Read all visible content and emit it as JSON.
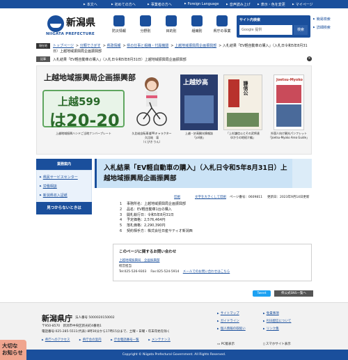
{
  "utility": {
    "items": [
      "本文へ",
      "初めての方へ",
      "事業者の方へ",
      "Foreign Language",
      "音声読み上げ",
      "表示・色を変更",
      "マイページ"
    ]
  },
  "header": {
    "logo_ja": "新潟県",
    "logo_en": "NIIGATA PREFECTURE",
    "nav": [
      "防災情報",
      "分野別",
      "目的別",
      "組織別",
      "県庁の事業"
    ],
    "search_title": "サイト内検索",
    "search_placeholder": "Google 提供",
    "search_button": "検索",
    "side_links": [
      "簡易検索",
      "詳細検索"
    ]
  },
  "breadcrumb": {
    "tag": "現在地",
    "items": [
      "トップページ",
      "分類でさがす",
      "県政情報",
      "県の仕事と組織・付属機関",
      "上越地域振興局企画振興部"
    ],
    "current": "入札結果「EV軽自動車の購入」（入札日令和5年8月31日）上越地域振興局企画振興部"
  },
  "news": {
    "tag": "記事",
    "text": "入札結果「EV軽自動車の購入」（入札日令和5年8月31日）上越地域振興局企画振興部"
  },
  "banner": {
    "title": "上越地域振興局企画振興部",
    "plate_line1": "上越599",
    "plate_line2": "は20-20",
    "captions": [
      "上越地域振興ハンドご当地ナンバープレート",
      "久比岐自転車道PRキャラクター\n久比岐　凛\n（くびき りん）",
      "上越・妙高観光情報誌\n「joli旅」",
      "「上杉謙信公とその武将達\nゆかりの地紹介編」",
      "外国人向け観光パンフレット\n「Joetsu-Myoko Area Guide」"
    ],
    "book_titles": [
      "上越妙高",
      "謙信公",
      "Joetsu-Myoko"
    ]
  },
  "left_nav": {
    "header": "業務案内",
    "items": [
      "県民サービスセンター",
      "労働相談",
      "新潟県収入証紙"
    ],
    "not_found": "見つからないときは"
  },
  "article": {
    "title": "入札結果「EV軽自動車の購入」（入札日令和5年8月31日）上越地域振興局企画振興部",
    "print": "印刷",
    "bigtext": "文字を大きくして印刷",
    "page_id": "ページ番号：0609811",
    "updated": "更新日：2023年9月14日更新",
    "items": [
      {
        "n": "1",
        "text": "事務所名：上越地域振興局企画振興部"
      },
      {
        "n": "2",
        "text": "品名：EV軽自動車1台の購入"
      },
      {
        "n": "3",
        "text": "開札執行日：令和5年8月31日"
      },
      {
        "n": "4",
        "text": "予定価格：2,576,464円"
      },
      {
        "n": "5",
        "text": "落札価格：2,290,390円"
      },
      {
        "n": "6",
        "text": "契約相手方：株式会社日産サティオ新潟西"
      }
    ],
    "contact_header": "このページに関するお問い合わせ",
    "contact_org": "上越地域振興局　企画振興部",
    "contact_dept": "経営担当",
    "contact_tel": "Tel:025-526-9303　 Fax:025-524-5914",
    "contact_mail": "メールでのお問い合わせはこちら",
    "tweet": "Tweet",
    "sns": "県公式SNS一覧へ"
  },
  "footer": {
    "name": "新潟県庁",
    "corp": "法人番号 5000020150002",
    "address1": "〒950-8570　新潟市中央区新光町4番地1",
    "address2": "電話番号:025-285-5511(代表)  8時30分から17時15分まで、土曜・日曜・年末年始を除く",
    "links": [
      "県庁へのアクセス",
      "県庁舎の案内",
      "庁舎電話番号一覧",
      "メンテナンス"
    ],
    "right_links": [
      "サイトマップ",
      "ガイドライン",
      "個人情報の取扱い",
      "免責事項",
      "RSS配信について",
      "リンク集"
    ],
    "pc_display": "PC版表示",
    "sp_display": "スマホサイト表示",
    "copyright": "Copyright © Niigata Prefectural Government. All Rights Reserved.",
    "badge": "大切な\nお知らせ"
  },
  "colors": {
    "brand_blue": "#1a4f9c",
    "title_bg": "#cbe3f6",
    "badge_bg": "#f0a58f"
  }
}
